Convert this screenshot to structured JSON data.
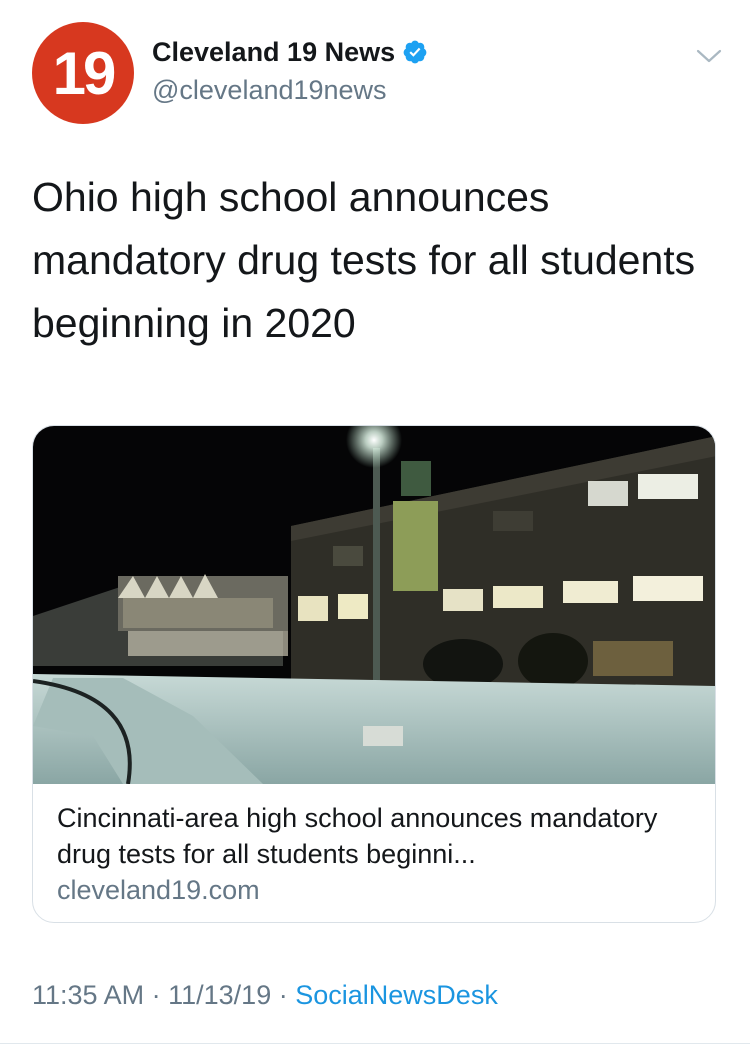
{
  "account": {
    "avatar_text": "19",
    "display_name": "Cleveland 19 News",
    "handle": "@cleveland19news",
    "verified": true,
    "avatar_color": "#d7381f",
    "verified_color": "#1da1f2"
  },
  "tweet": {
    "text": "Ohio high school announces mandatory drug tests for all students beginning in 2020",
    "time": "11:35 AM",
    "date": "11/13/19",
    "separator": "·",
    "source": "SocialNewsDesk"
  },
  "card": {
    "title": "Cincinnati-area high school announces mandatory drug tests for all students beginni...",
    "domain": "cleveland19.com",
    "image_description_icon": "school-night-photo"
  },
  "colors": {
    "text": "#14171a",
    "secondary": "#657786",
    "link": "#1b95e0"
  }
}
